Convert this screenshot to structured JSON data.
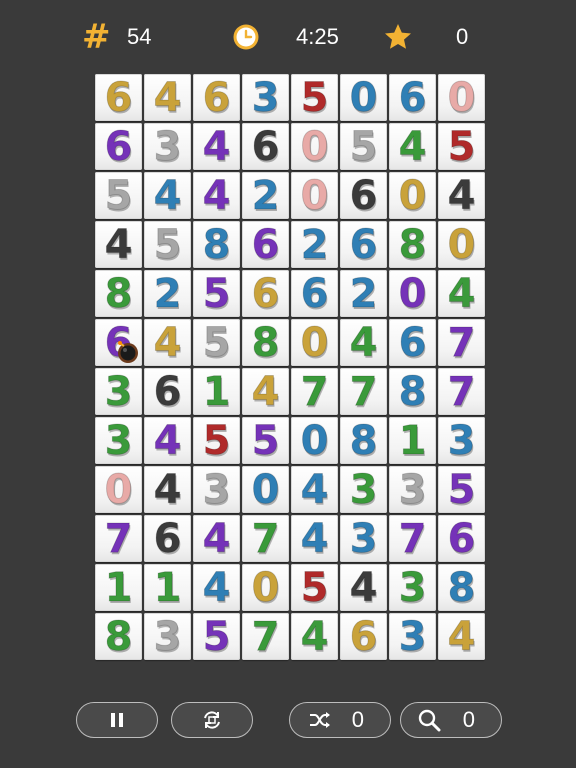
{
  "hud": {
    "moves_icon": "hash-icon",
    "moves_value": "54",
    "timer_icon": "clock-icon",
    "timer_value": "4:25",
    "score_icon": "star-icon",
    "score_value": "0"
  },
  "colors": {
    "background": "#3a3a3a",
    "hud_accent": "#f2b233",
    "tile": "#f5f5f5"
  },
  "digit_colors": {
    "gold": "#c9a23a",
    "blue": "#2f7fb5",
    "red": "#b02a2a",
    "pink": "#e8aaa7",
    "purple": "#7532b8",
    "silver": "#a6a6a6",
    "black": "#3b3b3b",
    "green": "#3a9a3a"
  },
  "board": {
    "rows": [
      [
        [
          "6",
          "gold"
        ],
        [
          "4",
          "gold"
        ],
        [
          "6",
          "gold"
        ],
        [
          "3",
          "blue"
        ],
        [
          "5",
          "red"
        ],
        [
          "0",
          "blue"
        ],
        [
          "6",
          "blue"
        ],
        [
          "0",
          "pink"
        ]
      ],
      [
        [
          "6",
          "purple"
        ],
        [
          "3",
          "silver"
        ],
        [
          "4",
          "purple"
        ],
        [
          "6",
          "black"
        ],
        [
          "0",
          "pink"
        ],
        [
          "5",
          "silver"
        ],
        [
          "4",
          "green"
        ],
        [
          "5",
          "red"
        ]
      ],
      [
        [
          "5",
          "silver"
        ],
        [
          "4",
          "blue"
        ],
        [
          "4",
          "purple"
        ],
        [
          "2",
          "blue"
        ],
        [
          "0",
          "pink"
        ],
        [
          "6",
          "black"
        ],
        [
          "0",
          "gold"
        ],
        [
          "4",
          "black"
        ]
      ],
      [
        [
          "4",
          "black"
        ],
        [
          "5",
          "silver"
        ],
        [
          "8",
          "blue"
        ],
        [
          "6",
          "purple"
        ],
        [
          "2",
          "blue"
        ],
        [
          "6",
          "blue"
        ],
        [
          "8",
          "green"
        ],
        [
          "0",
          "gold"
        ]
      ],
      [
        [
          "8",
          "green"
        ],
        [
          "2",
          "blue"
        ],
        [
          "5",
          "purple"
        ],
        [
          "6",
          "gold"
        ],
        [
          "6",
          "blue"
        ],
        [
          "2",
          "blue"
        ],
        [
          "0",
          "purple"
        ],
        [
          "4",
          "green"
        ]
      ],
      [
        [
          "6",
          "purple"
        ],
        [
          "4",
          "gold"
        ],
        [
          "5",
          "silver"
        ],
        [
          "8",
          "green"
        ],
        [
          "0",
          "gold"
        ],
        [
          "4",
          "green"
        ],
        [
          "6",
          "blue"
        ],
        [
          "7",
          "purple"
        ]
      ],
      [
        [
          "3",
          "green"
        ],
        [
          "6",
          "black"
        ],
        [
          "1",
          "green"
        ],
        [
          "4",
          "gold"
        ],
        [
          "7",
          "green"
        ],
        [
          "7",
          "green"
        ],
        [
          "8",
          "blue"
        ],
        [
          "7",
          "purple"
        ]
      ],
      [
        [
          "3",
          "green"
        ],
        [
          "4",
          "purple"
        ],
        [
          "5",
          "red"
        ],
        [
          "5",
          "purple"
        ],
        [
          "0",
          "blue"
        ],
        [
          "8",
          "blue"
        ],
        [
          "1",
          "green"
        ],
        [
          "3",
          "blue"
        ]
      ],
      [
        [
          "0",
          "pink"
        ],
        [
          "4",
          "black"
        ],
        [
          "3",
          "silver"
        ],
        [
          "0",
          "blue"
        ],
        [
          "4",
          "blue"
        ],
        [
          "3",
          "green"
        ],
        [
          "3",
          "silver"
        ],
        [
          "5",
          "purple"
        ]
      ],
      [
        [
          "7",
          "purple"
        ],
        [
          "6",
          "black"
        ],
        [
          "4",
          "purple"
        ],
        [
          "7",
          "green"
        ],
        [
          "4",
          "blue"
        ],
        [
          "3",
          "blue"
        ],
        [
          "7",
          "purple"
        ],
        [
          "6",
          "purple"
        ]
      ],
      [
        [
          "1",
          "green"
        ],
        [
          "1",
          "green"
        ],
        [
          "4",
          "blue"
        ],
        [
          "0",
          "gold"
        ],
        [
          "5",
          "red"
        ],
        [
          "4",
          "black"
        ],
        [
          "3",
          "green"
        ],
        [
          "8",
          "blue"
        ]
      ],
      [
        [
          "8",
          "green"
        ],
        [
          "3",
          "silver"
        ],
        [
          "5",
          "purple"
        ],
        [
          "7",
          "green"
        ],
        [
          "4",
          "green"
        ],
        [
          "6",
          "gold"
        ],
        [
          "3",
          "blue"
        ],
        [
          "4",
          "gold"
        ]
      ]
    ],
    "bomb": {
      "row": 5,
      "col": 0,
      "icon": "bomb-icon"
    }
  },
  "toolbar": {
    "pause_icon": "pause-icon",
    "replay_icon": "replay-icon",
    "shuffle_icon": "shuffle-icon",
    "shuffle_count": "0",
    "hint_icon": "search-icon",
    "hint_count": "0"
  }
}
